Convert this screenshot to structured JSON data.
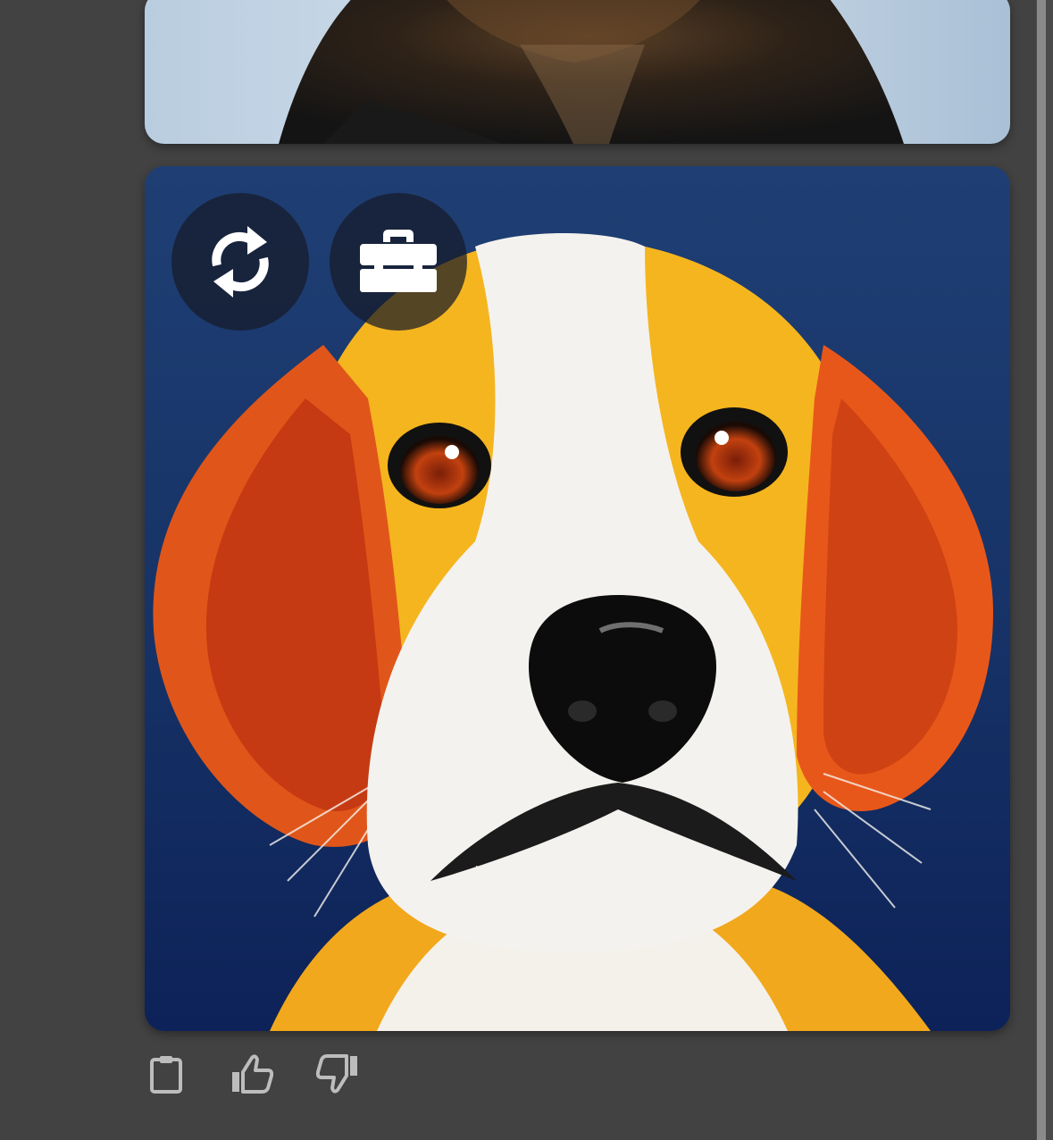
{
  "images": [
    {
      "subject": "dog-photo",
      "state": "partially-visible"
    },
    {
      "subject": "beagle-painting",
      "state": "visible"
    }
  ],
  "overlay_buttons": [
    {
      "icon": "refresh-icon"
    },
    {
      "icon": "toolbox-icon"
    }
  ],
  "action_bar": [
    {
      "icon": "clipboard-icon"
    },
    {
      "icon": "thumbs-up-icon"
    },
    {
      "icon": "thumbs-down-icon"
    }
  ],
  "colors": {
    "background": "#424242",
    "icon_gray": "#bdbdbd",
    "overlay": "#161a28",
    "scrollbar_thumb": "#8a8a8a"
  }
}
